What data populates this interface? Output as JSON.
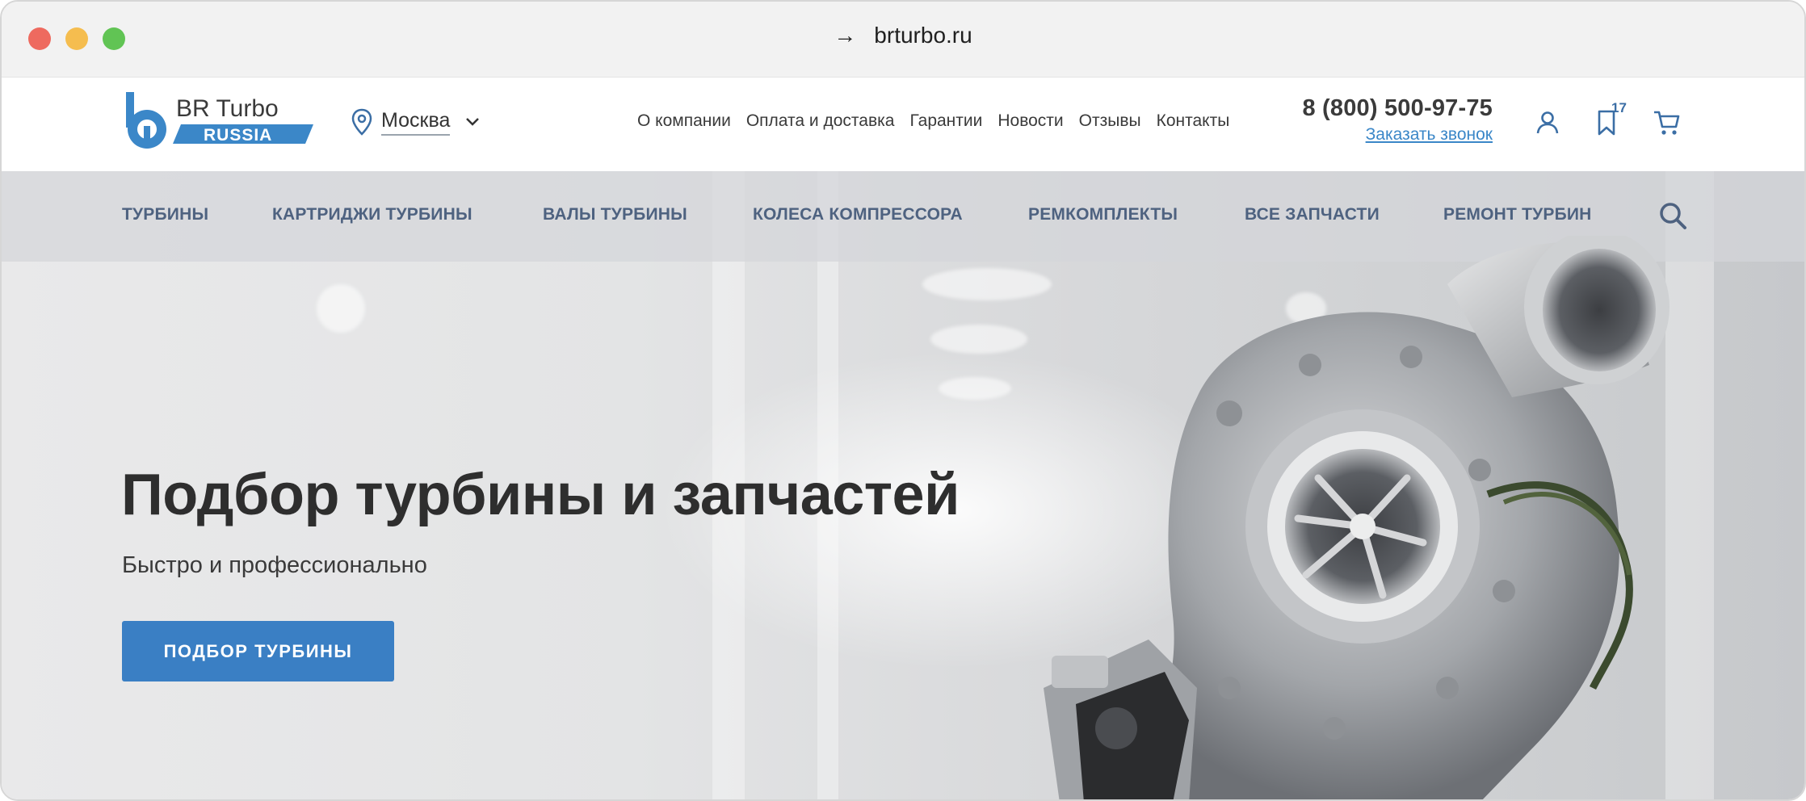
{
  "browser": {
    "arrow": "→",
    "url": "brturbo.ru"
  },
  "header": {
    "logo": {
      "line1": "BR Turbo",
      "line2": "RUSSIA"
    },
    "city": "Москва",
    "nav": [
      "О компании",
      "Оплата и доставка",
      "Гарантии",
      "Новости",
      "Отзывы",
      "Контакты"
    ],
    "phone": "8 (800) 500-97-75",
    "callback": "Заказать звонок",
    "favorites_count": "17",
    "icons": [
      "user-icon",
      "bookmark-icon",
      "cart-icon"
    ]
  },
  "categories": [
    "ТУРБИНЫ",
    "КАРТРИДЖИ ТУРБИНЫ",
    "ВАЛЫ ТУРБИНЫ",
    "КОЛЕСА КОМПРЕССОРА",
    "РЕМКОМПЛЕКТЫ",
    "ВСЕ ЗАПЧАСТИ",
    "РЕМОНТ ТУРБИН"
  ],
  "hero": {
    "title": "Подбор турбины и запчастей",
    "subtitle": "Быстро и профессионально",
    "button": "ПОДБОР ТУРБИНЫ"
  },
  "colors": {
    "accent": "#3a7fc4",
    "nav_text": "#4e6280",
    "logo_blue": "#3b87c8"
  }
}
